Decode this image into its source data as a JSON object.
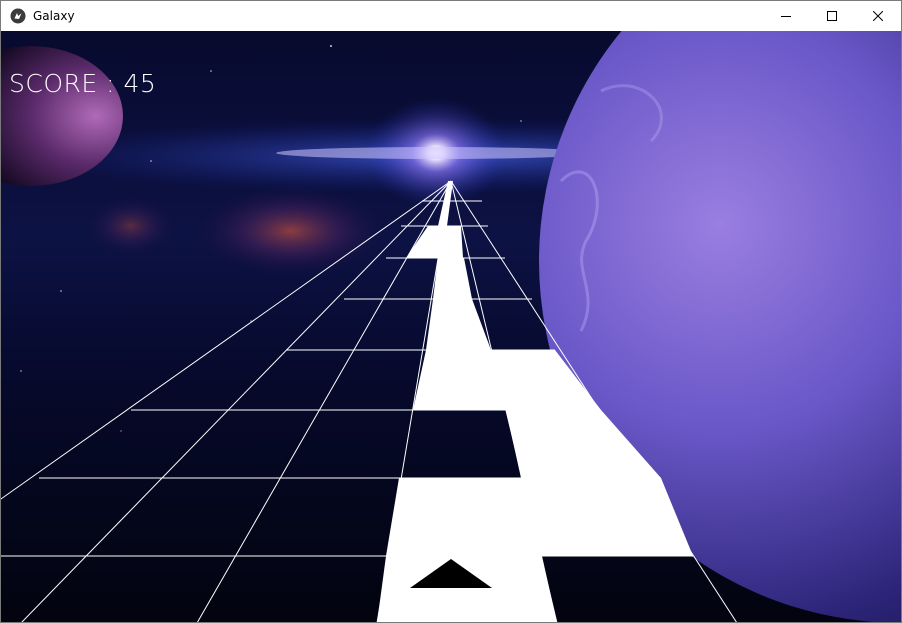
{
  "window": {
    "title": "Galaxy",
    "app_icon": "kivy-logo-icon",
    "controls": [
      "minimize-icon",
      "maximize-icon",
      "close-icon"
    ]
  },
  "hud": {
    "score_label": "SCORE : 45"
  },
  "scene": {
    "background": "starry-space-with-planets",
    "grid_color": "#ffffff",
    "tile_color": "#ffffff",
    "ship_color": "#000000",
    "ship_icon": "triangle-ship-icon"
  }
}
